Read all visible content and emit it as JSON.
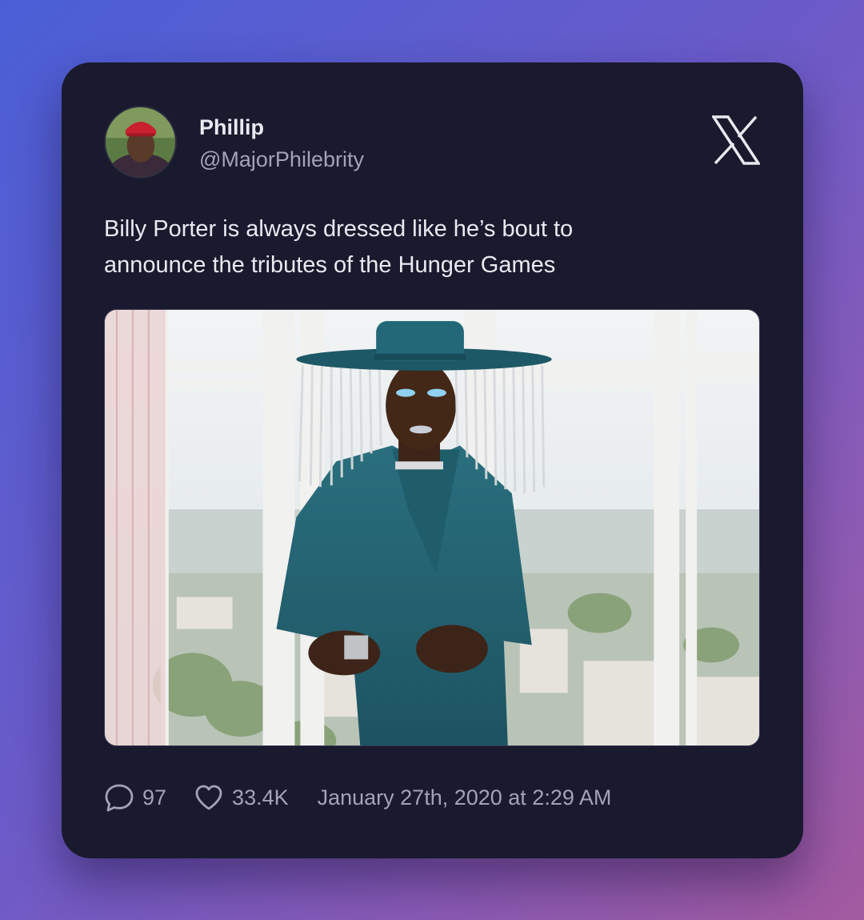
{
  "tweet": {
    "author_name": "Phillip",
    "author_handle": "@MajorPhilebrity",
    "text": "Billy Porter is always dressed like he’s bout to\nannounce the tributes of the Hunger Games",
    "replies": "97",
    "likes": "33.4K",
    "timestamp": "January 27th, 2020 at 2:29 AM"
  },
  "icons": {
    "brand": "x-logo-icon",
    "reply": "speech-bubble-icon",
    "like": "heart-icon"
  },
  "colors": {
    "card_background": "#1a1a2e",
    "primary_text": "#e9e9f2",
    "secondary_text": "#a3a3b8"
  }
}
